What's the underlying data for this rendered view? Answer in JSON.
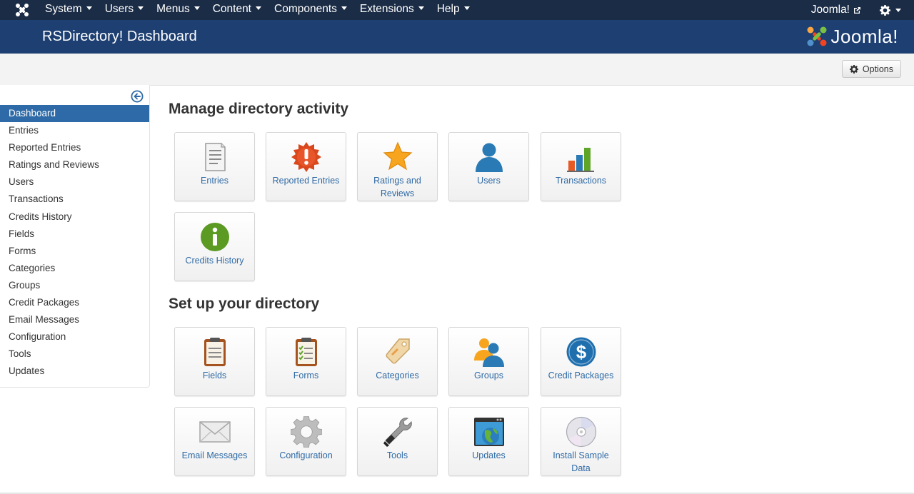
{
  "topnav": {
    "logo_icon": "joomla-icon",
    "menu": [
      "System",
      "Users",
      "Menus",
      "Content",
      "Components",
      "Extensions",
      "Help"
    ],
    "site_link": "Joomla!",
    "settings_icon": "gear-icon"
  },
  "header": {
    "title": "RSDirectory! Dashboard",
    "brand": "Joomla!"
  },
  "toolbar": {
    "options_label": "Options"
  },
  "sidebar": {
    "toggle_icon": "circle-arrow-left-icon",
    "items": [
      "Dashboard",
      "Entries",
      "Reported Entries",
      "Ratings and Reviews",
      "Users",
      "Transactions",
      "Credits History",
      "Fields",
      "Forms",
      "Categories",
      "Groups",
      "Credit Packages",
      "Email Messages",
      "Configuration",
      "Tools",
      "Updates"
    ],
    "active": "Dashboard"
  },
  "main": {
    "manage_title": "Manage directory activity",
    "manage_tiles": [
      {
        "label": "Entries",
        "icon": "document-icon"
      },
      {
        "label": "Reported Entries",
        "icon": "alert-icon"
      },
      {
        "label": "Ratings and Reviews",
        "icon": "star-icon"
      },
      {
        "label": "Users",
        "icon": "user-icon"
      },
      {
        "label": "Transactions",
        "icon": "bar-chart-icon"
      },
      {
        "label": "Credits History",
        "icon": "info-icon"
      }
    ],
    "setup_title": "Set up your directory",
    "setup_tiles": [
      {
        "label": "Fields",
        "icon": "clipboard-icon"
      },
      {
        "label": "Forms",
        "icon": "checklist-icon"
      },
      {
        "label": "Categories",
        "icon": "tag-icon"
      },
      {
        "label": "Groups",
        "icon": "users-icon"
      },
      {
        "label": "Credit Packages",
        "icon": "dollar-icon"
      },
      {
        "label": "Email Messages",
        "icon": "envelope-icon"
      },
      {
        "label": "Configuration",
        "icon": "gear-icon"
      },
      {
        "label": "Tools",
        "icon": "wrench-icon"
      },
      {
        "label": "Updates",
        "icon": "globe-window-icon"
      },
      {
        "label": "Install Sample Data",
        "icon": "disc-icon"
      }
    ]
  },
  "colors": {
    "navbar": "#1b2c46",
    "header": "#1d3f72",
    "active_item": "#2e6aa7",
    "tile_label": "#2f6aa5"
  }
}
